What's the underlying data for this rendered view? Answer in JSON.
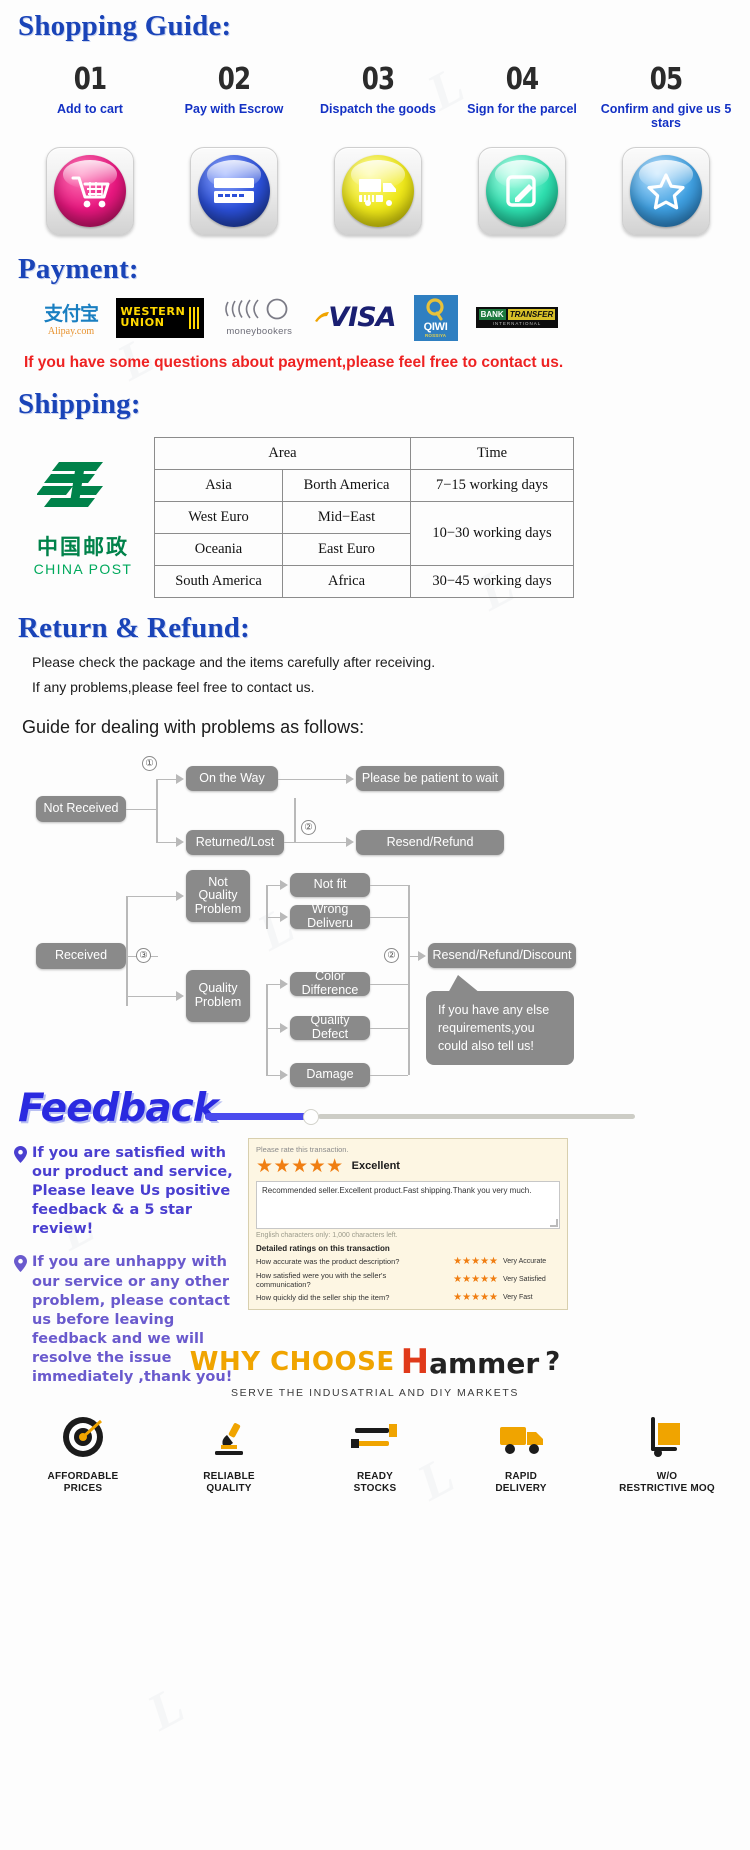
{
  "shopping_guide": {
    "title": "Shopping Guide:",
    "steps": [
      {
        "num": "01",
        "caption": "Add to cart",
        "icon": "shopping-cart-icon",
        "color": "#e8177f"
      },
      {
        "num": "02",
        "caption": "Pay with Escrow",
        "icon": "credit-card-icon",
        "color": "#2b4fd8"
      },
      {
        "num": "03",
        "caption": "Dispatch the goods",
        "icon": "delivery-truck-icon",
        "color": "#efe81a"
      },
      {
        "num": "04",
        "caption": "Sign for the parcel",
        "icon": "sign-document-icon",
        "color": "#2fe0b0"
      },
      {
        "num": "05",
        "caption": "Confirm and give us 5 stars",
        "icon": "star-icon",
        "color": "#3f9fe0"
      }
    ]
  },
  "payment": {
    "title": "Payment:",
    "logos": [
      {
        "name": "alipay-logo",
        "cn": "支付宝",
        "label": "Alipay.com"
      },
      {
        "name": "western-union-logo",
        "line1": "WESTERN",
        "line2": "UNION"
      },
      {
        "name": "moneybookers-logo",
        "label": "moneybookers"
      },
      {
        "name": "visa-logo",
        "label": "VISA"
      },
      {
        "name": "qiwi-logo",
        "label": "QIWI",
        "sub": "ROSSIYA"
      },
      {
        "name": "bank-transfer-logo",
        "a": "BANK",
        "b": "TRANSFER",
        "sub": "INTERNATIONAL"
      }
    ],
    "note": "If you have some questions about payment,please feel free to contact us."
  },
  "shipping": {
    "title": "Shipping:",
    "carrier": {
      "cn": "中国邮政",
      "en": "CHINA POST"
    },
    "table": {
      "headers": [
        "Area",
        "Time"
      ],
      "rows": [
        {
          "a": "Asia",
          "b": "Borth America",
          "time": "7−15 working days",
          "rowspan": 1
        },
        {
          "a": "West Euro",
          "b": "Mid−East",
          "time": "10−30 working days",
          "rowspan": 2
        },
        {
          "a": "Oceania",
          "b": "East Euro",
          "time": null,
          "rowspan": 0
        },
        {
          "a": "South America",
          "b": "Africa",
          "time": "30−45 working days",
          "rowspan": 1
        }
      ]
    }
  },
  "return_refund": {
    "title": "Return & Refund:",
    "lines": [
      "Please check the package and the items carefully after receiving.",
      "If any problems,please feel free to contact us."
    ],
    "guide_title": "Guide for dealing with problems as follows:",
    "flow": {
      "not_received": "Not Received",
      "received": "Received",
      "on_the_way": "On the Way",
      "returned_lost": "Returned/Lost",
      "be_patient": "Please be patient to wait",
      "resend_refund": "Resend/Refund",
      "not_quality_problem": "Not Quality Problem",
      "quality_problem": "Quality Problem",
      "not_fit": "Not fit",
      "wrong_delivery": "Wrong Deliveru",
      "color_difference": "Color Difference",
      "quality_defect": "Quality Defect",
      "damage": "Damage",
      "resend_refund_discount": "Resend/Refund/Discount",
      "callout": "If you have any else requirements,you could also tell us!",
      "marks": {
        "m1": "①",
        "m2": "②",
        "m3": "②",
        "m4": "③",
        "m5": "②"
      }
    }
  },
  "feedback": {
    "title": "Feedback",
    "points": [
      "If you are satisfied with our product and service, Please leave Us positive feedback & a 5 star review!",
      "If you are unhappy with our service or any other problem, please contact us before leaving feedback and we will resolve the issue immediately ,thank you!"
    ],
    "panel": {
      "rate_label": "Please rate this transaction.",
      "stars": "★★★★★",
      "excellent": "Excellent",
      "comment": "Recommended seller.Excellent product.Fast shipping.Thank you very much.",
      "hint": "English characters only: 1,000 characters left.",
      "detail_title": "Detailed ratings on this transaction",
      "rows": [
        {
          "question": "How accurate was the product description?",
          "stars": "★★★★★",
          "label": "Very Accurate"
        },
        {
          "question": "How satisfied were you with the seller's communication?",
          "stars": "★★★★★",
          "label": "Very Satisfied"
        },
        {
          "question": "How quickly did the seller ship the item?",
          "stars": "★★★★★",
          "label": "Very Fast"
        }
      ]
    }
  },
  "why_choose": {
    "prefix": "WHY CHOOSE",
    "brand_h": "H",
    "brand_rest": "ammer",
    "question": "?",
    "subtitle": "SERVE THE INDUSATRIAL AND DIY MARKETS",
    "items": [
      {
        "icon": "target-icon",
        "line1": "AFFORDABLE",
        "line2": "PRICES"
      },
      {
        "icon": "microscope-icon",
        "line1": "RELIABLE",
        "line2": "QUALITY"
      },
      {
        "icon": "wrench-icon",
        "line1": "READY",
        "line2": "STOCKS"
      },
      {
        "icon": "truck-icon",
        "line1": "RAPID",
        "line2": "DELIVERY"
      },
      {
        "icon": "hand-truck-icon",
        "line1": "W/O",
        "line2": "RESTRICTIVE MOQ"
      }
    ]
  }
}
